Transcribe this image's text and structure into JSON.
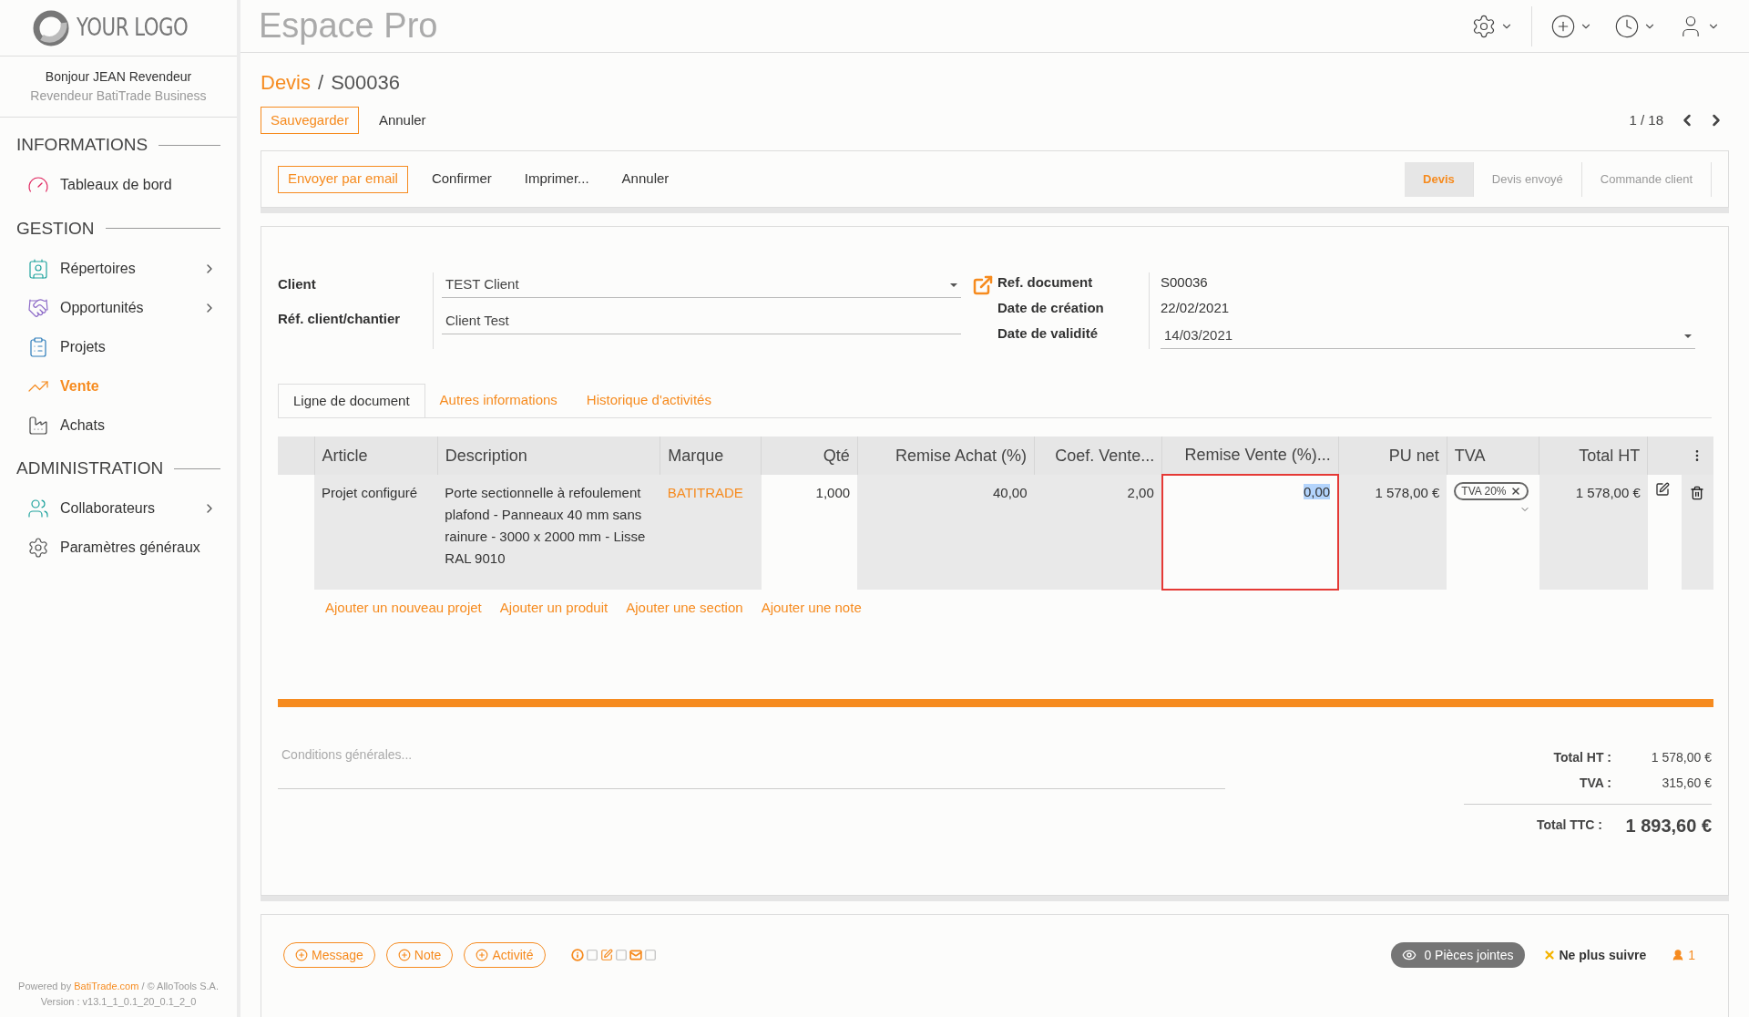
{
  "logo": {
    "text": "YOUR LOGO"
  },
  "app_title": "Espace Pro",
  "user": {
    "greeting": "Bonjour JEAN Revendeur",
    "role": "Revendeur BatiTrade Business"
  },
  "sidebar": {
    "sections": [
      {
        "title": "INFORMATIONS",
        "items": [
          {
            "label": "Tableaux de bord",
            "selected": false,
            "has_submenu": false
          }
        ]
      },
      {
        "title": "GESTION",
        "items": [
          {
            "label": "Répertoires",
            "selected": false,
            "has_submenu": true
          },
          {
            "label": "Opportunités",
            "selected": false,
            "has_submenu": true
          },
          {
            "label": "Projets",
            "selected": false,
            "has_submenu": false
          },
          {
            "label": "Vente",
            "selected": true,
            "has_submenu": false
          },
          {
            "label": "Achats",
            "selected": false,
            "has_submenu": false
          }
        ]
      },
      {
        "title": "ADMINISTRATION",
        "items": [
          {
            "label": "Collaborateurs",
            "selected": false,
            "has_submenu": true
          },
          {
            "label": "Paramètres généraux",
            "selected": false,
            "has_submenu": false
          }
        ]
      }
    ]
  },
  "footer": {
    "prefix": "Powered by",
    "link": "BatiTrade.com",
    "suffix": "/ © AlloTools S.A.",
    "version": "Version : v13.1_1_0.1_20_0.1_2_0"
  },
  "breadcrumb": {
    "parent": "Devis",
    "separator": "/",
    "current": "S00036"
  },
  "form_buttons": [
    {
      "label": "Sauvegarder",
      "primary": true
    },
    {
      "label": "Annuler",
      "primary": false
    }
  ],
  "pager": "1 / 18",
  "action_buttons": [
    {
      "label": "Envoyer par email",
      "primary": true
    },
    {
      "label": "Confirmer",
      "primary": false
    },
    {
      "label": "Imprimer...",
      "primary": false
    },
    {
      "label": "Annuler",
      "primary": false
    }
  ],
  "status_steps": [
    {
      "label": "Devis",
      "selected": true
    },
    {
      "label": "Devis envoyé",
      "selected": false
    },
    {
      "label": "Commande client",
      "selected": false
    }
  ],
  "fields_left": [
    {
      "label": "Client",
      "value": "TEST Client",
      "dropdown": true
    },
    {
      "label": "Réf. client/chantier",
      "value": "Client Test",
      "dropdown": false
    }
  ],
  "fields_right": [
    {
      "label": "Ref. document",
      "value": "S00036",
      "kind": "text"
    },
    {
      "label": "Date de création",
      "value": "22/02/2021",
      "kind": "text"
    },
    {
      "label": "Date de validité",
      "value": "14/03/2021",
      "kind": "select"
    }
  ],
  "tabs": [
    {
      "label": "Ligne de document",
      "selected": true
    },
    {
      "label": "Autres informations",
      "selected": false
    },
    {
      "label": "Historique d'activités",
      "selected": false
    }
  ],
  "table": {
    "columns": [
      {
        "label": "Article",
        "readonly": true,
        "focused": false
      },
      {
        "label": "Description",
        "readonly": true,
        "focused": false
      },
      {
        "label": "Marque",
        "readonly": true,
        "focused": false
      },
      {
        "label": "Qté",
        "readonly": false,
        "focused": false
      },
      {
        "label": "Remise Achat (%)",
        "readonly": true,
        "focused": false
      },
      {
        "label": "Coef. Vente...",
        "readonly": true,
        "focused": false
      },
      {
        "label": "Remise Vente (%)...",
        "readonly": false,
        "focused": true
      },
      {
        "label": "PU net",
        "readonly": true,
        "focused": false
      },
      {
        "label": "TVA",
        "readonly": false,
        "focused": false
      },
      {
        "label": "Total HT",
        "readonly": true,
        "focused": false
      }
    ],
    "rows": [
      {
        "cells": [
          {
            "kind": "text",
            "value": "Projet configuré"
          },
          {
            "kind": "text",
            "value": "Porte sectionnelle à refoulement plafond - Panneaux 40 mm sans rainure - 3000 x 2000 mm - Lisse RAL 9010"
          },
          {
            "kind": "link",
            "value": "BATITRADE"
          },
          {
            "kind": "text",
            "value": "1,000"
          },
          {
            "kind": "text",
            "value": "40,00"
          },
          {
            "kind": "text",
            "value": "2,00"
          },
          {
            "kind": "input",
            "value": "0,00"
          },
          {
            "kind": "text",
            "value": "1 578,00 €"
          },
          {
            "kind": "tag",
            "value": "TVA 20%"
          },
          {
            "kind": "text",
            "value": "1 578,00 €"
          }
        ]
      }
    ]
  },
  "add_links": [
    "Ajouter un nouveau projet",
    "Ajouter un produit",
    "Ajouter une section",
    "Ajouter une note"
  ],
  "conditions": {
    "placeholder": "Conditions générales..."
  },
  "totals": [
    {
      "label": "Total HT :",
      "value": "1 578,00 €",
      "grand": false
    },
    {
      "label": "TVA :",
      "value": "315,60 €",
      "grand": false
    },
    {
      "label": "Total TTC :",
      "value": "1 893,60 €",
      "grand": true
    }
  ],
  "chatter": {
    "buttons": [
      "Message",
      "Note",
      "Activité"
    ],
    "attachments": "0 Pièces jointes",
    "unfollow": "Ne plus suivre",
    "followers": "1"
  }
}
